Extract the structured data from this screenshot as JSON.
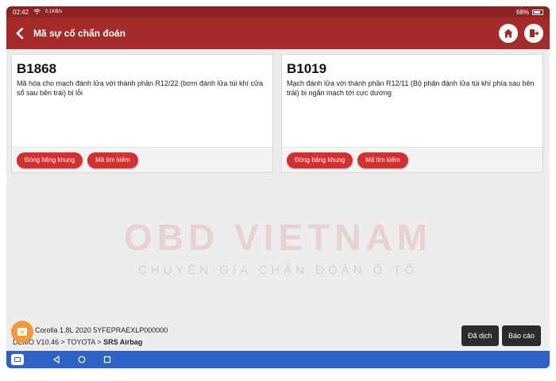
{
  "status": {
    "time": "02:42",
    "net_speed": "0,1KB/s",
    "battery": "68%"
  },
  "header": {
    "title": "Mã sự cố chẩn đoán",
    "icons": {
      "back": "chevron-left-icon",
      "home": "home-icon",
      "exit": "exit-icon"
    }
  },
  "dtc_cards": [
    {
      "code": "B1868",
      "description": "Mã hóa cho mạch đánh lửa với thành phần R12/22 (bơm đánh lửa túi khí cửa sổ sau bên trái) bị lỗi",
      "freeze_label": "Đóng băng khung",
      "search_label": "Mã tìm kiếm"
    },
    {
      "code": "B1019",
      "description": "Mạch đánh lửa với thành phần R12/11 (Bộ phận đánh lửa túi khí phía sau bên trái) bị ngắn mạch tới cực dương",
      "freeze_label": "Đóng băng khung",
      "search_label": "Mã tìm kiếm"
    }
  ],
  "watermark": {
    "main": "OBD VIETNAM",
    "sub": "CHUYÊN GIA CHẨN ĐOÁN Ô TÔ"
  },
  "footer": {
    "vehicle": "Corolla 1.8L 2020  5YFEPRAEXLP000000",
    "path_prefix": "DEMO V10.46 > TOYOTA > ",
    "path_last": "SRS Airbag",
    "translated_label": "Đã dịch",
    "report_label": "Báo cáo"
  },
  "colors": {
    "appbar": "#a52a2a",
    "button_red": "#d62f2f",
    "nav_blue": "#2f62c4",
    "fab_orange": "#f29a3a"
  }
}
